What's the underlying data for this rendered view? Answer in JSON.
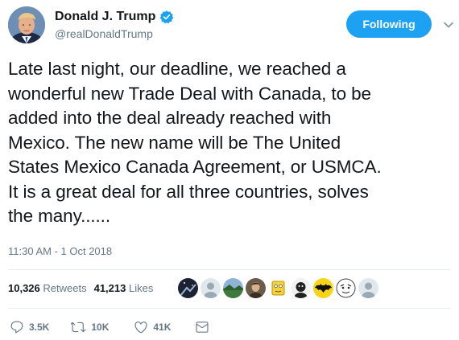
{
  "user": {
    "display_name": "Donald J. Trump",
    "handle": "@realDonaldTrump",
    "verified": true
  },
  "follow_button": {
    "label": "Following"
  },
  "tweet": {
    "text": "Late last night, our deadline, we reached a\nwonderful new Trade Deal with Canada, to be\nadded into the deal already reached with\nMexico. The new name will be The United\nStates Mexico Canada Agreement, or USMCA.\nIt is a great deal for all three countries, solves\nthe many......",
    "timestamp": "11:30 AM - 1 Oct 2018"
  },
  "stats": {
    "retweets_count": "10,326",
    "retweets_label": "Retweets",
    "likes_count": "41,213",
    "likes_label": "Likes"
  },
  "liker_avatars": [
    {
      "name": "liker-avatar-1",
      "icon": "space-photo"
    },
    {
      "name": "liker-avatar-2",
      "icon": "default-person"
    },
    {
      "name": "liker-avatar-3",
      "icon": "landscape"
    },
    {
      "name": "liker-avatar-4",
      "icon": "portrait"
    },
    {
      "name": "liker-avatar-5",
      "icon": "yellow-character"
    },
    {
      "name": "liker-avatar-6",
      "icon": "dark-figure"
    },
    {
      "name": "liker-avatar-7",
      "icon": "batman-logo"
    },
    {
      "name": "liker-avatar-8",
      "icon": "cartoon"
    },
    {
      "name": "liker-avatar-9",
      "icon": "default-person"
    }
  ],
  "actions": {
    "reply_count": "3.5K",
    "retweet_count": "10K",
    "like_count": "41K"
  },
  "colors": {
    "accent": "#1da1f2",
    "text": "#14171a",
    "muted": "#657786",
    "divider": "#e6ecf0"
  }
}
